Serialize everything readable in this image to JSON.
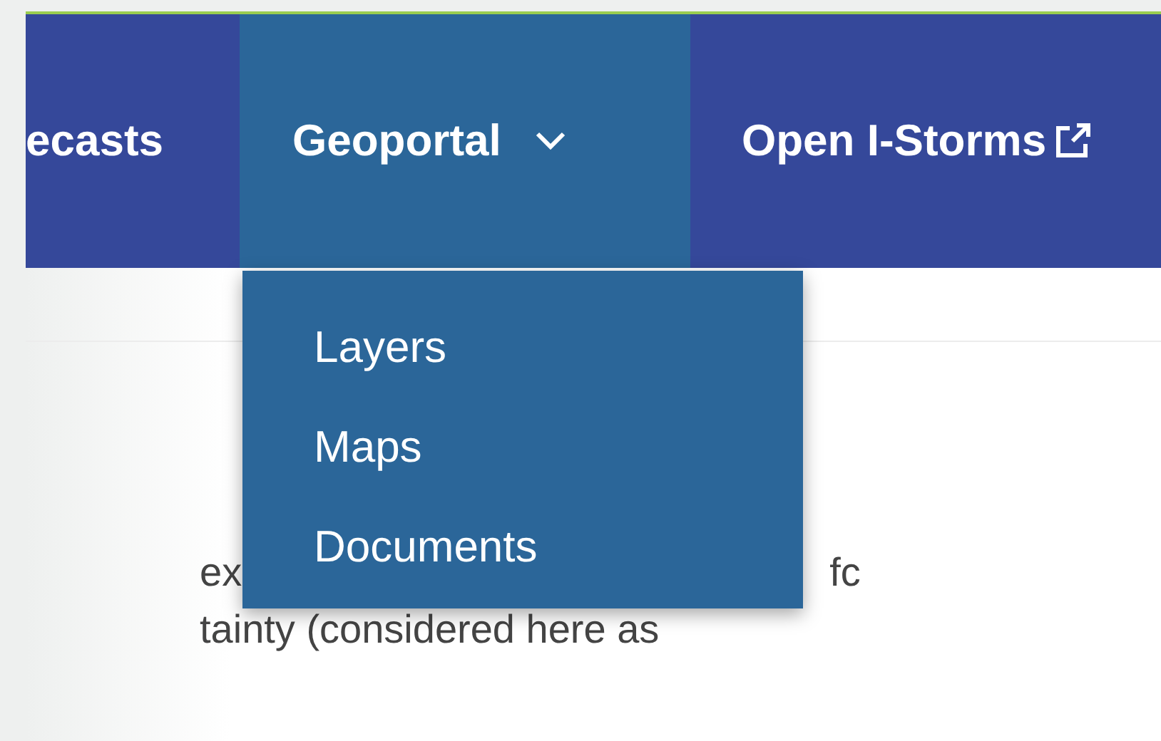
{
  "nav": {
    "items": [
      {
        "label": "ecasts",
        "selected": false,
        "dropdown": false,
        "external": false
      },
      {
        "label": "Geoportal",
        "selected": true,
        "dropdown": true,
        "external": false
      },
      {
        "label": "Open I-Storms",
        "selected": false,
        "dropdown": false,
        "external": true
      }
    ]
  },
  "dropdown": {
    "items": [
      {
        "label": "Layers"
      },
      {
        "label": "Maps"
      },
      {
        "label": "Documents"
      }
    ]
  },
  "body_text": [
    {
      "fragments": [
        "ex",
        "fc"
      ]
    },
    {
      "fragments": [
        "tainty (considered here as"
      ]
    }
  ]
}
